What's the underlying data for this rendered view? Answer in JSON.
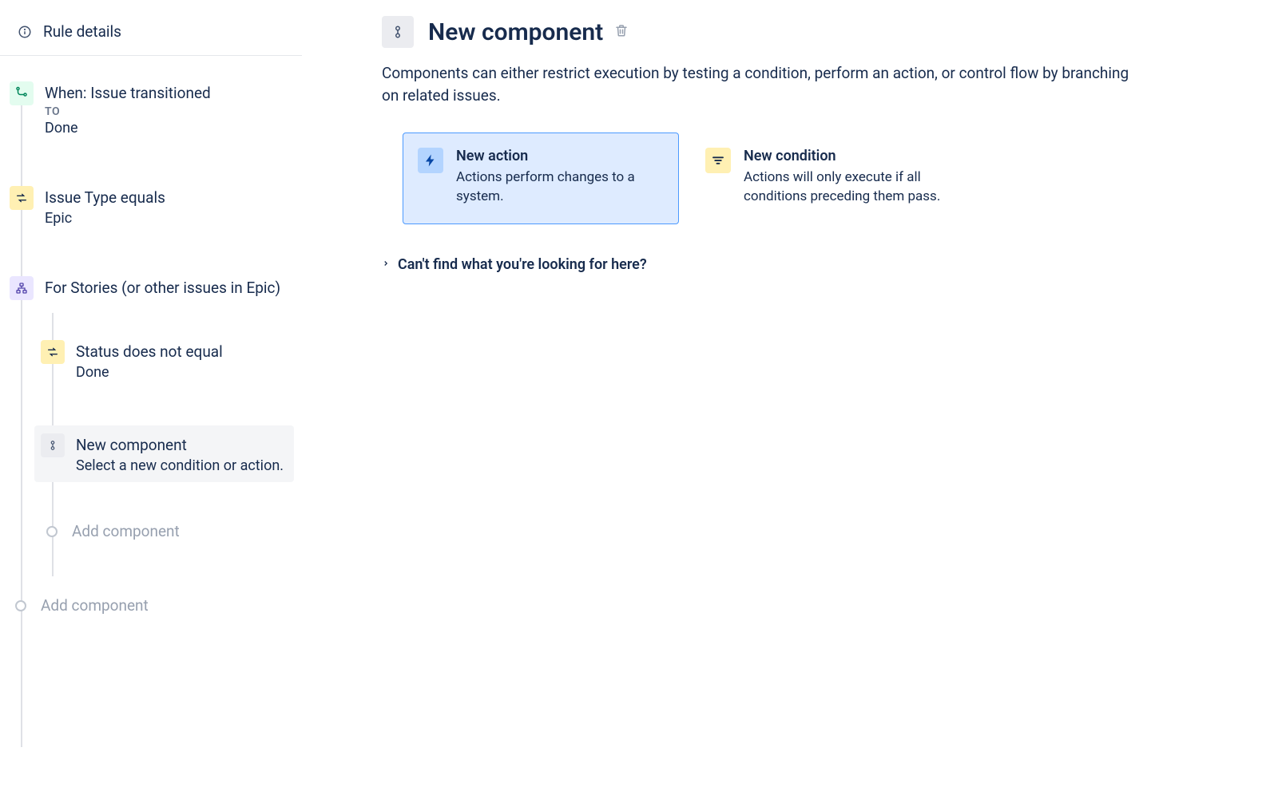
{
  "sidebar": {
    "rule_details_label": "Rule details",
    "trigger": {
      "title": "When: Issue transitioned",
      "meta": "TO",
      "sub": "Done"
    },
    "condition1": {
      "title": "Issue Type equals",
      "sub": "Epic"
    },
    "branch": {
      "title": "For Stories (or other issues in Epic)"
    },
    "nested_condition": {
      "title": "Status does not equal",
      "sub": "Done"
    },
    "new_component": {
      "title": "New component",
      "sub": "Select a new condition or action."
    },
    "add_component_label": "Add component"
  },
  "main": {
    "title": "New component",
    "description": "Components can either restrict execution by testing a condition, perform an action, or control flow by branching on related issues.",
    "cards": {
      "action": {
        "title": "New action",
        "desc": "Actions perform changes to a system."
      },
      "condition": {
        "title": "New condition",
        "desc": "Actions will only execute if all conditions preceding them pass."
      }
    },
    "help_text": "Can't find what you're looking for here?"
  }
}
